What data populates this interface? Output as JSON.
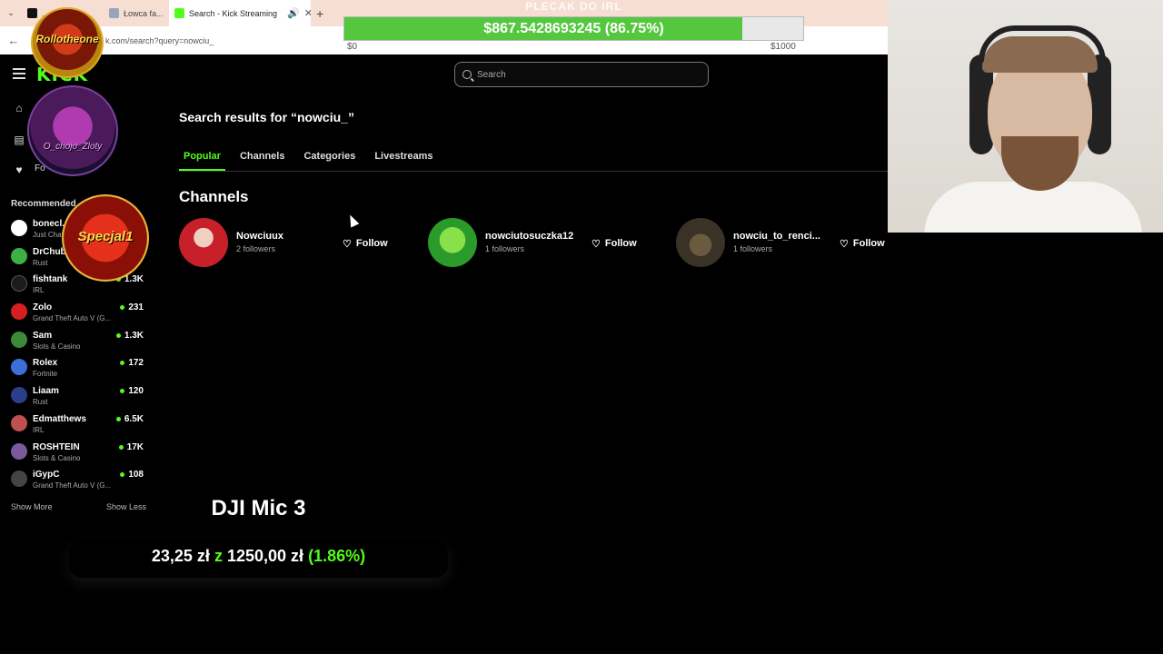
{
  "browser": {
    "tabs": [
      {
        "label": "... ",
        "icon": "x-logo-icon",
        "color": "#111111"
      },
      {
        "label": "Łowca fa...",
        "icon": "page-icon",
        "color": "#9aa4c0"
      },
      {
        "label": "Search - Kick Streaming",
        "icon": "kick-icon",
        "color": "#53fc18"
      }
    ],
    "url": "k.com/search?query=nowciu_"
  },
  "goal": {
    "title": "PLECAK DO IRL",
    "amount_text": "$867.5428693245 (86.75%)",
    "progress": 0.8675,
    "min_label": "$0",
    "max_label": "$1000",
    "color": "#55c73f"
  },
  "header": {
    "logo": "KICK",
    "search_placeholder": "Search"
  },
  "sidebar": {
    "following_label": "Fo",
    "recommended_title": "Recommended",
    "channels": [
      {
        "name": "bonecl...",
        "category": "Just Chatting",
        "viewers": "",
        "color": "#ffffff"
      },
      {
        "name": "DrChub...",
        "category": "Rust",
        "viewers": "",
        "color": "#3cb043"
      },
      {
        "name": "fishtank",
        "category": "IRL",
        "viewers": "1.3K",
        "color": "#1b1b1b"
      },
      {
        "name": "Zolo",
        "category": "Grand Theft Auto V (G...",
        "viewers": "231",
        "color": "#d62020"
      },
      {
        "name": "Sam",
        "category": "Slots & Casino",
        "viewers": "1.3K",
        "color": "#3a8a3a"
      },
      {
        "name": "Rolex",
        "category": "Fortnite",
        "viewers": "172",
        "color": "#3a6fd8"
      },
      {
        "name": "Liaam",
        "category": "Rust",
        "viewers": "120",
        "color": "#2a3f8a"
      },
      {
        "name": "Edmatthews",
        "category": "IRL",
        "viewers": "6.5K",
        "color": "#c05050"
      },
      {
        "name": "ROSHTEIN",
        "category": "Slots & Casino",
        "viewers": "17K",
        "color": "#7a5a9a"
      },
      {
        "name": "iGypC",
        "category": "Grand Theft Auto V (G...",
        "viewers": "108",
        "color": "#444444"
      }
    ],
    "show_more": "Show More",
    "show_less": "Show Less"
  },
  "overlay_badges": {
    "rollo": "Rollotheone",
    "ochoja": "O_chojo_Zloty",
    "specjal": "Specjal1"
  },
  "main": {
    "title": "Search results for “nowciu_”",
    "tabs": [
      "Popular",
      "Channels",
      "Categories",
      "Livestreams"
    ],
    "active_tab": "Popular",
    "section_title": "Channels",
    "results": [
      {
        "name": "Nowciuux",
        "followers": "2 followers",
        "follow_label": "Follow",
        "avatar_color": "#c8202a"
      },
      {
        "name": "nowciutosuczka12",
        "followers": "1 followers",
        "follow_label": "Follow",
        "avatar_color": "#2a9a2a"
      },
      {
        "name": "nowciu_to_renci...",
        "followers": "1 followers",
        "follow_label": "Follow",
        "avatar_color": "#3a3226"
      }
    ]
  },
  "dji": {
    "title": "DJI Mic 3",
    "current": "23,25 zł",
    "separator": "z",
    "target": "1250,00 zł",
    "percent": "(1.86%)"
  }
}
